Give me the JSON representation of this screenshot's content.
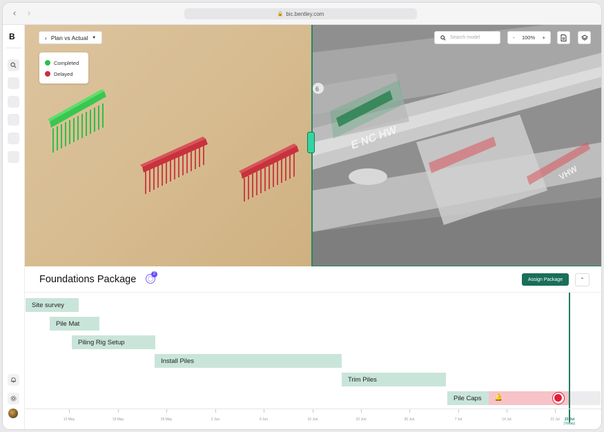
{
  "browser": {
    "url": "bic.bentley.com"
  },
  "app": {
    "logo": "B"
  },
  "viewer": {
    "plan_button": "Plan vs Actual",
    "legend": [
      {
        "label": "Completed",
        "color": "#2fbf4a"
      },
      {
        "label": "Delayed",
        "color": "#c8323c"
      }
    ],
    "search_placeholder": "Search model",
    "zoom": {
      "minus": "-",
      "value": "100%",
      "plus": "+"
    },
    "colors": {
      "completed": "#2fbf4a",
      "delayed": "#c8323c",
      "accent": "#1f8a66"
    }
  },
  "package": {
    "title": "Foundations Package",
    "badge_count": "2",
    "assign_button": "Assign Package"
  },
  "gantt": {
    "tasks": [
      {
        "label": "Site survey"
      },
      {
        "label": "Pile Mat"
      },
      {
        "label": "Piling Rig Setup"
      },
      {
        "label": "Install Piles"
      },
      {
        "label": "Trim Piles"
      },
      {
        "label": "Pile Caps"
      }
    ],
    "timeline": [
      "12 May",
      "19 May",
      "26 May",
      "2 Jun",
      "9 Jun",
      "16 Jun",
      "23 Jun",
      "30 Jun",
      "7 Jul",
      "14 Jul",
      "21 Jul",
      "23 Jul",
      "(Today)"
    ]
  }
}
